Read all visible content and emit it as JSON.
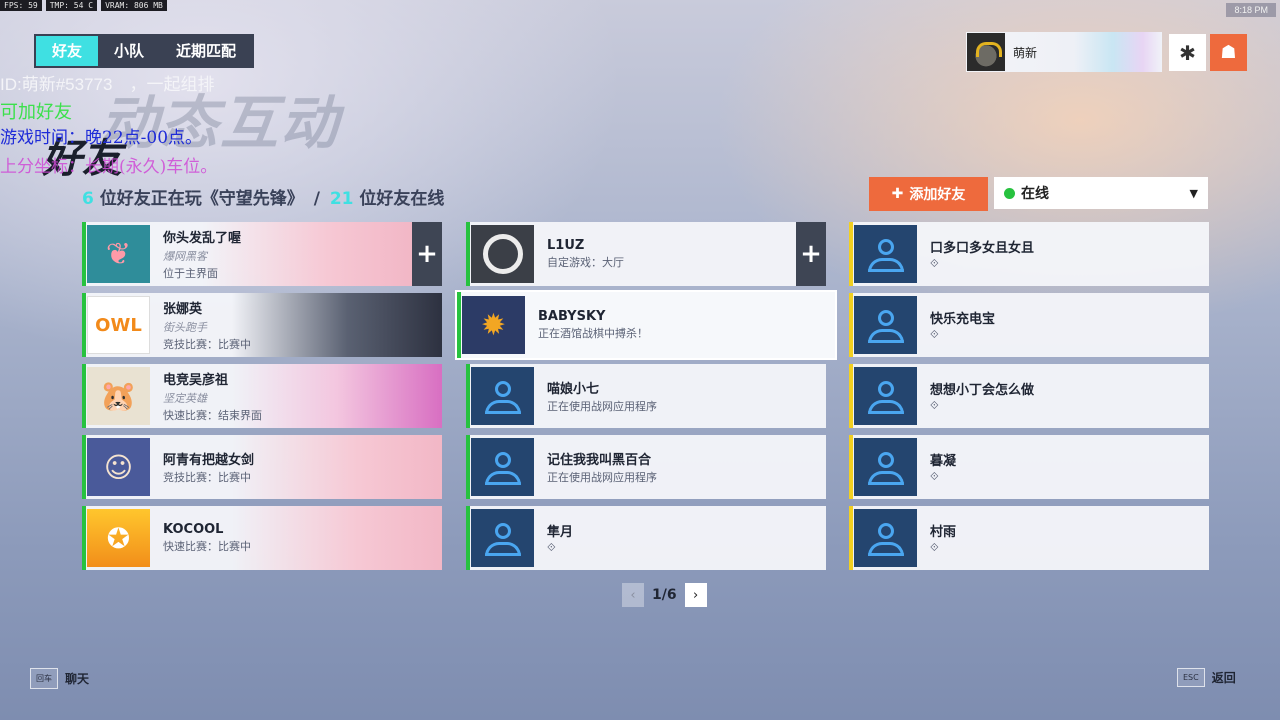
{
  "perf": {
    "fps": "FPS:  59",
    "tmp": "TMP:  54 C",
    "vram": "VRAM: 806 MB"
  },
  "clock": "8:18 PM",
  "tabs": [
    {
      "label": "好友",
      "active": true
    },
    {
      "label": "小队",
      "active": false
    },
    {
      "label": "近期匹配",
      "active": false
    }
  ],
  "overlay": {
    "id_line": "ID:萌新#53773　，一起组排",
    "add_line": "可加好友",
    "time_line": "游戏时间：晚22点-00点。",
    "pos_line": "上分坐标：长期(永久)车位。"
  },
  "ghost_title": "动态互动",
  "page_title": "好友",
  "profile": {
    "name": "萌新"
  },
  "summary": {
    "playing_count": "6",
    "playing_text": "位好友正在玩《守望先锋》",
    "separator": "/",
    "online_count": "21",
    "online_text": "位好友在线"
  },
  "add_friend_label": "添加好友",
  "status_select": {
    "value": "在线"
  },
  "friends": [
    {
      "name": "你头发乱了喔",
      "title": "爆网黑客",
      "status": "位于主界面"
    },
    {
      "name": "张娜英",
      "title": "街头跑手",
      "status": "竞技比赛：比赛中"
    },
    {
      "name": "电竞吴彦祖",
      "title": "坚定英雄",
      "status": "快速比赛：结束界面"
    },
    {
      "name": "阿青有把越女剑",
      "title": "",
      "status": "竞技比赛：比赛中"
    },
    {
      "name": "KOCOOL",
      "title": "",
      "status": "快速比赛：比赛中"
    },
    {
      "name": "L1UZ",
      "title": "",
      "status": "自定游戏：大厅"
    },
    {
      "name": "BABYSKY",
      "title": "",
      "status": "正在酒馆战棋中搏杀！"
    },
    {
      "name": "喵娘小七",
      "title": "",
      "status": "正在使用战网应用程序"
    },
    {
      "name": "记住我我叫黑百合",
      "title": "",
      "status": "正在使用战网应用程序"
    },
    {
      "name": "隼月",
      "title": "",
      "status": ""
    },
    {
      "name": "口多口多女且女且",
      "title": "",
      "status": ""
    },
    {
      "name": "快乐充电宝",
      "title": "",
      "status": ""
    },
    {
      "name": "想想小丁会怎么做",
      "title": "",
      "status": ""
    },
    {
      "name": "暮凝",
      "title": "",
      "status": ""
    },
    {
      "name": "村雨",
      "title": "",
      "status": ""
    }
  ],
  "pager": {
    "label": "1/6"
  },
  "footer": {
    "chat_key": "回车",
    "chat_label": "聊天",
    "back_key": "ESC",
    "back_label": "返回"
  },
  "colors": {
    "accent": "#3fe0e2",
    "orange": "#ee6a3d",
    "online_green": "#27c23f",
    "away_yellow": "#f2d021"
  }
}
